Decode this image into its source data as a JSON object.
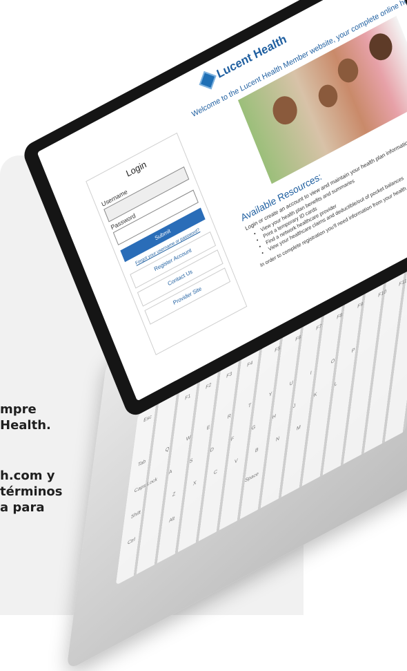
{
  "background_text": {
    "line1": "mpre",
    "line2": "Health.",
    "line3": "h.com y",
    "line4": "términos",
    "line5": "a para"
  },
  "site": {
    "logo_text": "Lucent Health",
    "welcome": "Welcome to the Lucent Health Member website, your complete online he"
  },
  "login": {
    "title": "Login",
    "username_label": "Username",
    "password_label": "Password",
    "submit_label": "Submit",
    "forgot_link": "Forgot your username or password?",
    "register_button": "Register Account",
    "contact_button": "Contact Us",
    "provider_button": "Provider Site"
  },
  "resources": {
    "title": "Available Resources:",
    "intro": "Login or create an account to view and maintain your health plan information. Fro",
    "items": [
      "View your health plan benefits and summaries",
      "Print a temporary ID cards",
      "Find a network healthcare provider",
      "View your healthcare claims and deductible/out of pocket balances"
    ],
    "footer": "In order to complete registration you'll need information from your health c"
  },
  "keyboard": {
    "keys": [
      "Esc",
      "F1",
      "F2",
      "F3",
      "F4",
      "F5",
      "F6",
      "F7",
      "F8",
      "F9",
      "F10",
      "F11",
      "Tab",
      "Q",
      "W",
      "E",
      "R",
      "T",
      "Y",
      "U",
      "I",
      "O",
      "P",
      "Caps Lock",
      "A",
      "S",
      "D",
      "F",
      "G",
      "H",
      "J",
      "K",
      "L",
      "Shift",
      "Z",
      "X",
      "C",
      "V",
      "B",
      "N",
      "M",
      "Ctrl",
      "Alt",
      "Space"
    ]
  }
}
